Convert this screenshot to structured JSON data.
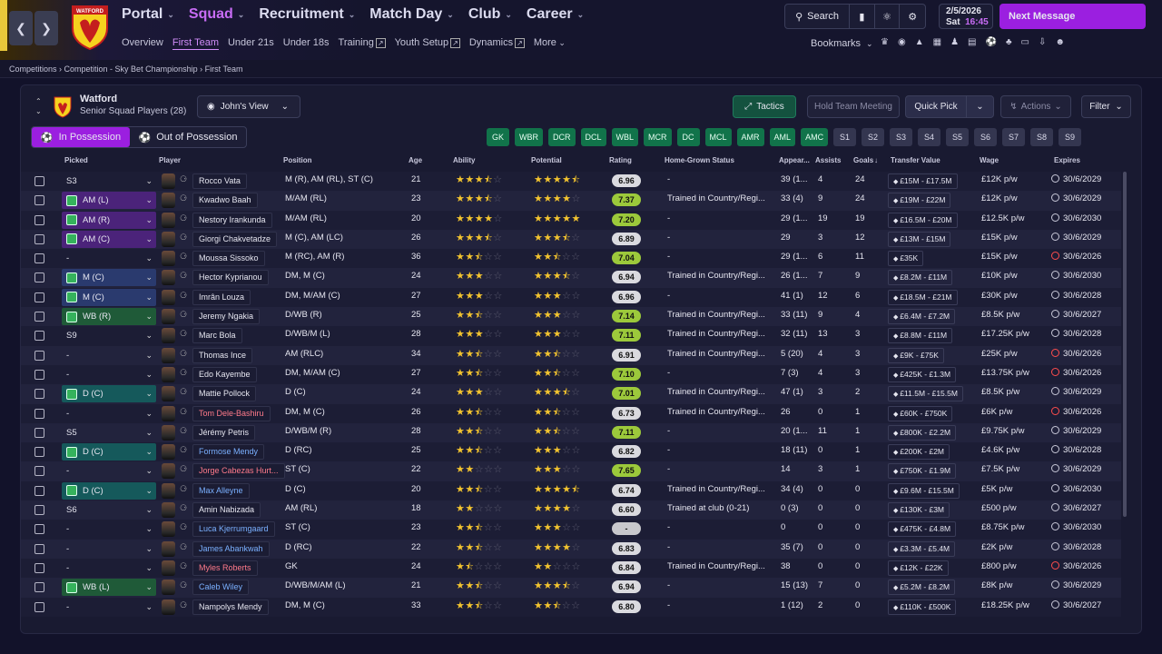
{
  "nav": {
    "main": [
      {
        "label": "Portal",
        "active": false
      },
      {
        "label": "Squad",
        "active": true
      },
      {
        "label": "Recruitment",
        "active": false
      },
      {
        "label": "Match Day",
        "active": false
      },
      {
        "label": "Club",
        "active": false
      },
      {
        "label": "Career",
        "active": false
      }
    ],
    "sub": [
      {
        "label": "Overview",
        "active": false,
        "ext": false
      },
      {
        "label": "First Team",
        "active": true,
        "ext": false
      },
      {
        "label": "Under 21s",
        "active": false,
        "ext": false
      },
      {
        "label": "Under 18s",
        "active": false,
        "ext": false
      },
      {
        "label": "Training",
        "active": false,
        "ext": true
      },
      {
        "label": "Youth Setup",
        "active": false,
        "ext": true
      },
      {
        "label": "Dynamics",
        "active": false,
        "ext": true
      },
      {
        "label": "More",
        "active": false,
        "ext": false,
        "chev": true
      }
    ]
  },
  "header": {
    "search_label": "Search",
    "date": "2/5/2026",
    "day": "Sat",
    "time": "16:45",
    "next_message": "Next Message",
    "bookmarks": "Bookmarks",
    "club_crest_text": "WATFORD"
  },
  "breadcrumb": {
    "items": [
      "Competitions",
      "Competition - Sky Bet Championship",
      "First Team"
    ]
  },
  "panel": {
    "team_name": "Watford",
    "subtitle": "Senior Squad Players (28)",
    "view": "John's View",
    "tactics": "Tactics",
    "hold_meeting": "Hold Team Meeting",
    "quick_pick": "Quick Pick",
    "actions": "Actions",
    "filter": "Filter",
    "in_possession": "In Possession",
    "out_possession": "Out of Possession",
    "position_filters": [
      {
        "label": "GK",
        "active": true
      },
      {
        "label": "WBR",
        "active": true
      },
      {
        "label": "DCR",
        "active": true
      },
      {
        "label": "DCL",
        "active": true
      },
      {
        "label": "WBL",
        "active": true
      },
      {
        "label": "MCR",
        "active": true
      },
      {
        "label": "DC",
        "active": true
      },
      {
        "label": "MCL",
        "active": true
      },
      {
        "label": "AMR",
        "active": true
      },
      {
        "label": "AML",
        "active": true
      },
      {
        "label": "AMC",
        "active": true
      },
      {
        "label": "S1",
        "active": false
      },
      {
        "label": "S2",
        "active": false
      },
      {
        "label": "S3",
        "active": false
      },
      {
        "label": "S4",
        "active": false
      },
      {
        "label": "S5",
        "active": false
      },
      {
        "label": "S6",
        "active": false
      },
      {
        "label": "S7",
        "active": false
      },
      {
        "label": "S8",
        "active": false
      },
      {
        "label": "S9",
        "active": false
      }
    ],
    "columns": {
      "picked": "Picked",
      "player": "Player",
      "position": "Position",
      "age": "Age",
      "ability": "Ability",
      "potential": "Potential",
      "rating": "Rating",
      "hgs": "Home-Grown Status",
      "apps": "Appear...",
      "assists": "Assists",
      "goals": "Goals",
      "tv": "Transfer Value",
      "wage": "Wage",
      "expires": "Expires"
    }
  },
  "players": [
    {
      "pick": "S3",
      "pickType": "bench",
      "name": "Rocco Vata",
      "nameColor": "",
      "pos": "M (R), AM (RL), ST (C)",
      "age": "21",
      "ab": 3.5,
      "pot": 4.5,
      "rating": "6.96",
      "rc": "dark",
      "hgs": "-",
      "apps": "39 (1...",
      "ast": "4",
      "goals": "24",
      "tv": "£15M - £17.5M",
      "wage": "£12K p/w",
      "exp": "30/6/2029",
      "expRed": false
    },
    {
      "pick": "AM (L)",
      "pickType": "att",
      "name": "Kwadwo Baah",
      "nameColor": "",
      "pos": "M/AM (RL)",
      "age": "23",
      "ab": 3.5,
      "pot": 4.0,
      "rating": "7.37",
      "rc": "green",
      "hgs": "Trained in Country/Regi...",
      "apps": "33 (4)",
      "ast": "9",
      "goals": "24",
      "tv": "£19M - £22M",
      "wage": "£12K p/w",
      "exp": "30/6/2029",
      "expRed": false
    },
    {
      "pick": "AM (R)",
      "pickType": "att",
      "name": "Nestory Irankunda",
      "nameColor": "",
      "pos": "M/AM (RL)",
      "age": "20",
      "ab": 4.0,
      "pot": 5.0,
      "rating": "7.20",
      "rc": "green",
      "hgs": "-",
      "apps": "29 (1...",
      "ast": "19",
      "goals": "19",
      "tv": "£16.5M - £20M",
      "wage": "£12.5K p/w",
      "exp": "30/6/2030",
      "expRed": false
    },
    {
      "pick": "AM (C)",
      "pickType": "att",
      "name": "Giorgi Chakvetadze",
      "nameColor": "",
      "pos": "M (C), AM (LC)",
      "age": "26",
      "ab": 3.5,
      "pot": 3.5,
      "rating": "6.89",
      "rc": "dark",
      "hgs": "-",
      "apps": "29",
      "ast": "3",
      "goals": "12",
      "tv": "£13M - £15M",
      "wage": "£15K p/w",
      "exp": "30/6/2029",
      "expRed": false
    },
    {
      "pick": "-",
      "pickType": "bench",
      "name": "Moussa Sissoko",
      "nameColor": "",
      "pos": "M (RC), AM (R)",
      "age": "36",
      "ab": 2.5,
      "pot": 2.5,
      "rating": "7.04",
      "rc": "green",
      "hgs": "-",
      "apps": "29 (1...",
      "ast": "6",
      "goals": "11",
      "tv": "£35K",
      "wage": "£15K p/w",
      "exp": "30/6/2026",
      "expRed": true
    },
    {
      "pick": "M (C)",
      "pickType": "mid",
      "name": "Hector Kyprianou",
      "nameColor": "",
      "pos": "DM, M (C)",
      "age": "24",
      "ab": 3.0,
      "pot": 3.5,
      "rating": "6.94",
      "rc": "dark",
      "hgs": "Trained in Country/Regi...",
      "apps": "26 (1...",
      "ast": "7",
      "goals": "9",
      "tv": "£8.2M - £11M",
      "wage": "£10K p/w",
      "exp": "30/6/2030",
      "expRed": false
    },
    {
      "pick": "M (C)",
      "pickType": "mid",
      "name": "Imrân Louza",
      "nameColor": "",
      "pos": "DM, M/AM (C)",
      "age": "27",
      "ab": 3.0,
      "pot": 3.0,
      "rating": "6.96",
      "rc": "dark",
      "hgs": "-",
      "apps": "41 (1)",
      "ast": "12",
      "goals": "6",
      "tv": "£18.5M - £21M",
      "wage": "£30K p/w",
      "exp": "30/6/2028",
      "expRed": false
    },
    {
      "pick": "WB (R)",
      "pickType": "wb",
      "name": "Jeremy Ngakia",
      "nameColor": "",
      "pos": "D/WB (R)",
      "age": "25",
      "ab": 2.5,
      "pot": 3.0,
      "rating": "7.14",
      "rc": "green",
      "hgs": "Trained in Country/Regi...",
      "apps": "33 (11)",
      "ast": "9",
      "goals": "4",
      "tv": "£6.4M - £7.2M",
      "wage": "£8.5K p/w",
      "exp": "30/6/2027",
      "expRed": false
    },
    {
      "pick": "S9",
      "pickType": "bench",
      "name": "Marc Bola",
      "nameColor": "",
      "pos": "D/WB/M (L)",
      "age": "28",
      "ab": 3.0,
      "pot": 3.0,
      "rating": "7.11",
      "rc": "green",
      "hgs": "Trained in Country/Regi...",
      "apps": "32 (11)",
      "ast": "13",
      "goals": "3",
      "tv": "£8.8M - £11M",
      "wage": "£17.25K p/w",
      "exp": "30/6/2028",
      "expRed": false
    },
    {
      "pick": "-",
      "pickType": "bench",
      "name": "Thomas Ince",
      "nameColor": "",
      "pos": "AM (RLC)",
      "age": "34",
      "ab": 2.5,
      "pot": 2.5,
      "rating": "6.91",
      "rc": "dark",
      "hgs": "Trained in Country/Regi...",
      "apps": "5 (20)",
      "ast": "4",
      "goals": "3",
      "tv": "£9K - £75K",
      "wage": "£25K p/w",
      "exp": "30/6/2026",
      "expRed": true
    },
    {
      "pick": "-",
      "pickType": "bench",
      "name": "Edo Kayembe",
      "nameColor": "",
      "pos": "DM, M/AM (C)",
      "age": "27",
      "ab": 2.5,
      "pot": 2.5,
      "rating": "7.10",
      "rc": "green",
      "hgs": "-",
      "apps": "7 (3)",
      "ast": "4",
      "goals": "3",
      "tv": "£425K - £1.3M",
      "wage": "£13.75K p/w",
      "exp": "30/6/2026",
      "expRed": true
    },
    {
      "pick": "D (C)",
      "pickType": "def",
      "name": "Mattie Pollock",
      "nameColor": "",
      "pos": "D (C)",
      "age": "24",
      "ab": 3.0,
      "pot": 3.5,
      "rating": "7.01",
      "rc": "green",
      "hgs": "Trained in Country/Regi...",
      "apps": "47 (1)",
      "ast": "3",
      "goals": "2",
      "tv": "£11.5M - £15.5M",
      "wage": "£8.5K p/w",
      "exp": "30/6/2029",
      "expRed": false
    },
    {
      "pick": "-",
      "pickType": "bench",
      "name": "Tom Dele-Bashiru",
      "nameColor": "red",
      "pos": "DM, M (C)",
      "age": "26",
      "ab": 2.5,
      "pot": 2.5,
      "rating": "6.73",
      "rc": "dark",
      "hgs": "Trained in Country/Regi...",
      "apps": "26",
      "ast": "0",
      "goals": "1",
      "tv": "£60K - £750K",
      "wage": "£6K p/w",
      "exp": "30/6/2026",
      "expRed": true
    },
    {
      "pick": "S5",
      "pickType": "bench",
      "name": "Jérémy Petris",
      "nameColor": "",
      "pos": "D/WB/M (R)",
      "age": "28",
      "ab": 2.5,
      "pot": 2.5,
      "rating": "7.11",
      "rc": "green",
      "hgs": "-",
      "apps": "20 (1...",
      "ast": "11",
      "goals": "1",
      "tv": "£800K - £2.2M",
      "wage": "£9.75K p/w",
      "exp": "30/6/2029",
      "expRed": false
    },
    {
      "pick": "D (C)",
      "pickType": "def",
      "name": "Formose Mendy",
      "nameColor": "blue",
      "pos": "D (RC)",
      "age": "25",
      "ab": 2.5,
      "pot": 3.0,
      "rating": "6.82",
      "rc": "dark",
      "hgs": "-",
      "apps": "18 (11)",
      "ast": "0",
      "goals": "1",
      "tv": "£200K - £2M",
      "wage": "£4.6K p/w",
      "exp": "30/6/2028",
      "expRed": false
    },
    {
      "pick": "-",
      "pickType": "bench",
      "name": "Jorge Cabezas Hurt...",
      "nameColor": "red",
      "pos": "ST (C)",
      "age": "22",
      "ab": 2.0,
      "pot": 3.0,
      "rating": "7.65",
      "rc": "green",
      "hgs": "-",
      "apps": "14",
      "ast": "3",
      "goals": "1",
      "tv": "£750K - £1.9M",
      "wage": "£7.5K p/w",
      "exp": "30/6/2029",
      "expRed": false
    },
    {
      "pick": "D (C)",
      "pickType": "def",
      "name": "Max Alleyne",
      "nameColor": "blue",
      "pos": "D (C)",
      "age": "20",
      "ab": 2.5,
      "pot": 4.5,
      "rating": "6.74",
      "rc": "dark",
      "hgs": "Trained in Country/Regi...",
      "apps": "34 (4)",
      "ast": "0",
      "goals": "0",
      "tv": "£9.6M - £15.5M",
      "wage": "£5K p/w",
      "exp": "30/6/2030",
      "expRed": false
    },
    {
      "pick": "S6",
      "pickType": "bench",
      "name": "Amin Nabizada",
      "nameColor": "",
      "pos": "AM (RL)",
      "age": "18",
      "ab": 2.0,
      "pot": 4.0,
      "rating": "6.60",
      "rc": "dark",
      "hgs": "Trained at club (0-21)",
      "apps": "0 (3)",
      "ast": "0",
      "goals": "0",
      "tv": "£130K - £3M",
      "wage": "£500 p/w",
      "exp": "30/6/2027",
      "expRed": false
    },
    {
      "pick": "-",
      "pickType": "bench",
      "name": "Luca Kjerrumgaard",
      "nameColor": "blue",
      "pos": "ST (C)",
      "age": "23",
      "ab": 2.5,
      "pot": 3.0,
      "rating": "-",
      "rc": "none",
      "hgs": "-",
      "apps": "0",
      "ast": "0",
      "goals": "0",
      "tv": "£475K - £4.8M",
      "wage": "£8.75K p/w",
      "exp": "30/6/2030",
      "expRed": false
    },
    {
      "pick": "-",
      "pickType": "bench",
      "name": "James Abankwah",
      "nameColor": "blue",
      "pos": "D (RC)",
      "age": "22",
      "ab": 2.5,
      "pot": 4.0,
      "rating": "6.83",
      "rc": "dark",
      "hgs": "-",
      "apps": "35 (7)",
      "ast": "0",
      "goals": "0",
      "tv": "£3.3M - £5.4M",
      "wage": "£2K p/w",
      "exp": "30/6/2028",
      "expRed": false
    },
    {
      "pick": "-",
      "pickType": "bench",
      "name": "Myles Roberts",
      "nameColor": "red",
      "pos": "GK",
      "age": "24",
      "ab": 1.5,
      "pot": 2.0,
      "rating": "6.84",
      "rc": "dark",
      "hgs": "Trained in Country/Regi...",
      "apps": "38",
      "ast": "0",
      "goals": "0",
      "tv": "£12K - £22K",
      "wage": "£800 p/w",
      "exp": "30/6/2026",
      "expRed": true
    },
    {
      "pick": "WB (L)",
      "pickType": "wb",
      "name": "Caleb Wiley",
      "nameColor": "blue",
      "pos": "D/WB/M/AM (L)",
      "age": "21",
      "ab": 2.5,
      "pot": 3.5,
      "rating": "6.94",
      "rc": "dark",
      "hgs": "-",
      "apps": "15 (13)",
      "ast": "7",
      "goals": "0",
      "tv": "£5.2M - £8.2M",
      "wage": "£8K p/w",
      "exp": "30/6/2029",
      "expRed": false
    },
    {
      "pick": "-",
      "pickType": "bench",
      "name": "Nampolys Mendy",
      "nameColor": "",
      "pos": "DM, M (C)",
      "age": "33",
      "ab": 2.5,
      "pot": 2.5,
      "rating": "6.80",
      "rc": "dark",
      "hgs": "-",
      "apps": "1 (12)",
      "ast": "2",
      "goals": "0",
      "tv": "£110K - £500K",
      "wage": "£18.25K p/w",
      "exp": "30/6/2027",
      "expRed": false
    }
  ]
}
